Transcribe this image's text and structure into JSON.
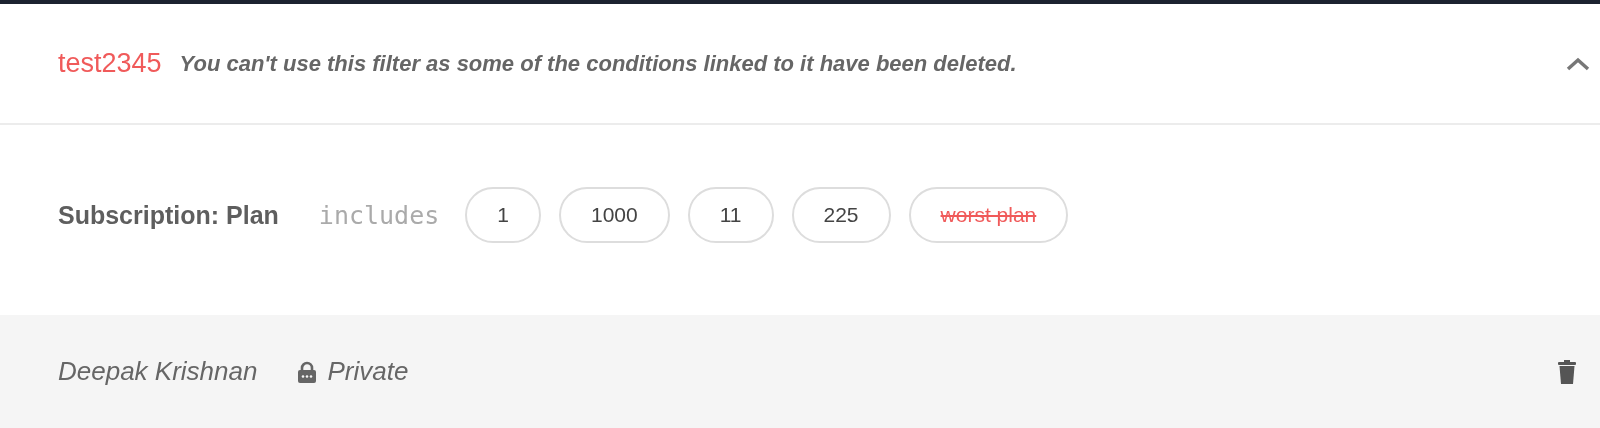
{
  "filter": {
    "name": "test2345",
    "warning": "You can't use this filter as some of the conditions linked to it have been deleted.",
    "expanded": true
  },
  "condition": {
    "field": "Subscription: Plan",
    "operator": "includes",
    "values": [
      {
        "label": "1",
        "deleted": false
      },
      {
        "label": "1000",
        "deleted": false
      },
      {
        "label": "11",
        "deleted": false
      },
      {
        "label": "225",
        "deleted": false
      },
      {
        "label": "worst plan",
        "deleted": true
      }
    ]
  },
  "footer": {
    "owner": "Deepak Krishnan",
    "visibility": "Private"
  }
}
